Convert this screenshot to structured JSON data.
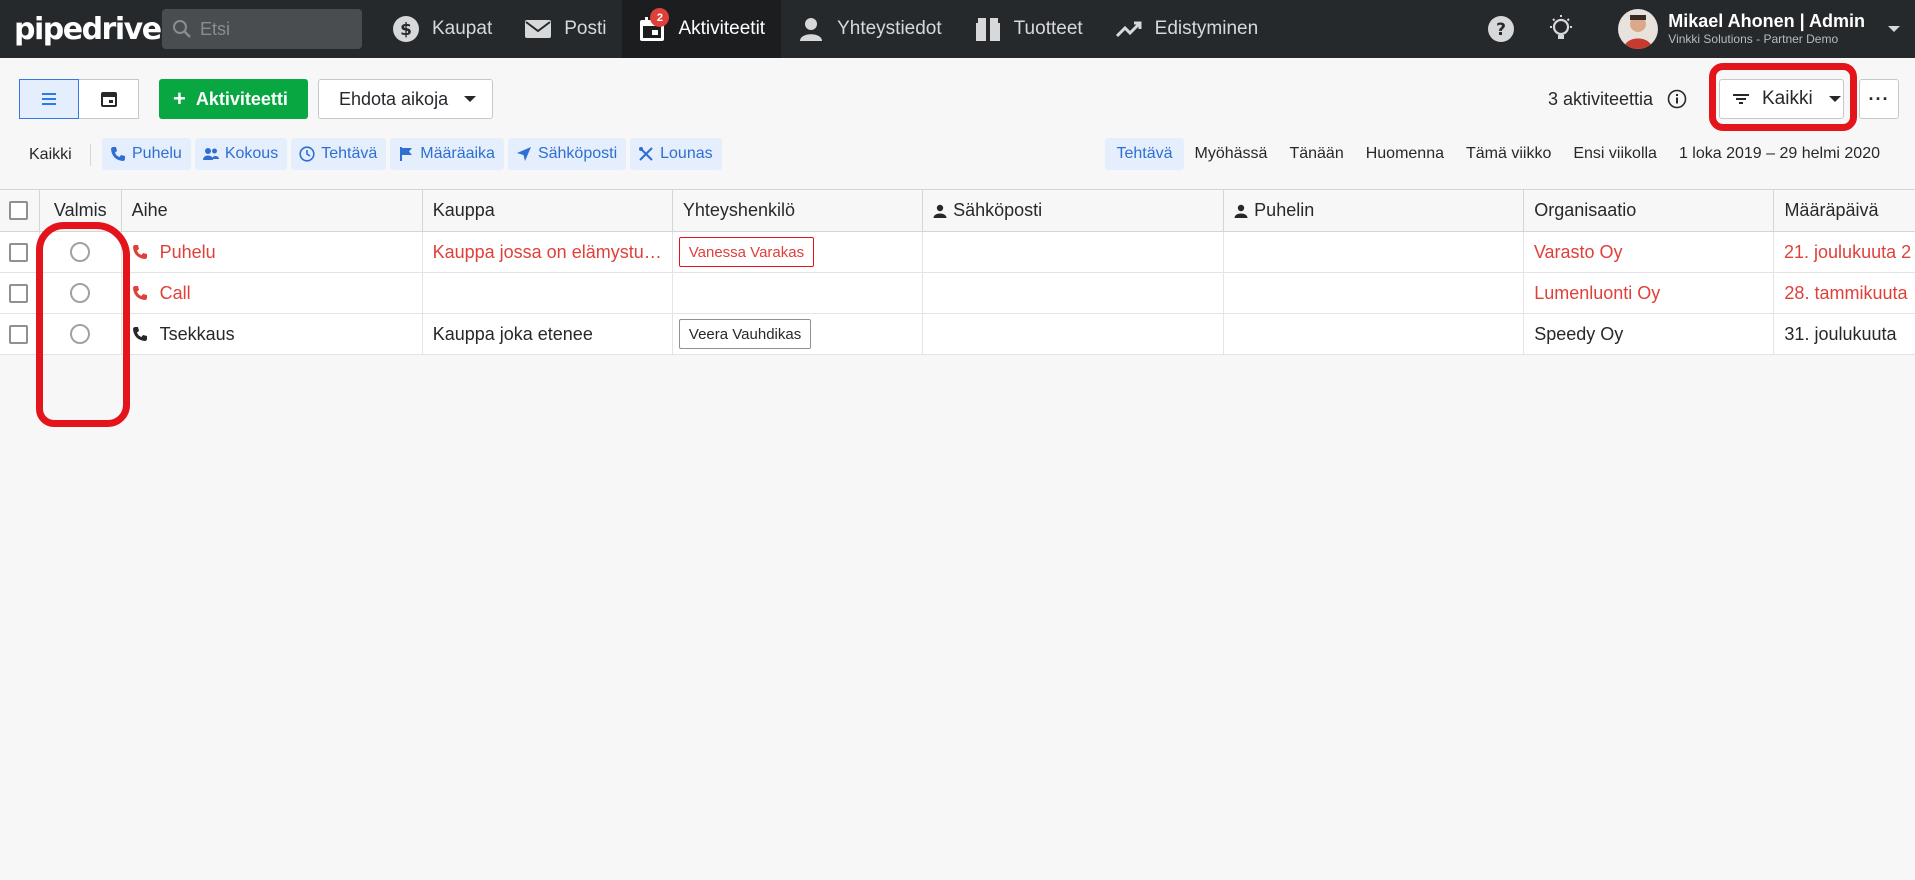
{
  "nav": {
    "logo": "pipedrive",
    "search_placeholder": "Etsi",
    "items": [
      {
        "label": "Kaupat",
        "icon": "dollar-icon"
      },
      {
        "label": "Posti",
        "icon": "mail-icon"
      },
      {
        "label": "Aktiviteetit",
        "icon": "calendar-icon",
        "badge": "2",
        "active": true
      },
      {
        "label": "Yhteystiedot",
        "icon": "person-icon"
      },
      {
        "label": "Tuotteet",
        "icon": "box-icon"
      },
      {
        "label": "Edistyminen",
        "icon": "trend-icon"
      }
    ],
    "user_name": "Mikael Ahonen | Admin",
    "user_company": "Vinkki Solutions - Partner Demo"
  },
  "toolbar": {
    "add_label": "Aktiviteetti",
    "suggest_label": "Ehdota aikoja",
    "count_label": "3 aktiviteettia",
    "filter_label": "Kaikki",
    "more_label": "···"
  },
  "types": {
    "all_label": "Kaikki",
    "chips": [
      "Puhelu",
      "Kokous",
      "Tehtävä",
      "Määräaika",
      "Sähköposti",
      "Lounas"
    ]
  },
  "periods": [
    "Tehtävä",
    "Myöhässä",
    "Tänään",
    "Huomenna",
    "Tämä viikko",
    "Ensi viikolla",
    "1 loka 2019 – 29 helmi 2020"
  ],
  "table": {
    "headers": {
      "done": "Valmis",
      "subject": "Aihe",
      "deal": "Kauppa",
      "person": "Yhteyshenkilö",
      "email": "Sähköposti",
      "phone": "Puhelin",
      "org": "Organisaatio",
      "due": "Määräpäivä"
    },
    "rows": [
      {
        "subject": "Puhelu",
        "deal": "Kauppa jossa on elämystu…",
        "person": "Vanessa Varakas",
        "org": "Varasto Oy",
        "due": "21. joulukuuta 2",
        "overdue": true
      },
      {
        "subject": "Call",
        "deal": "",
        "person": "",
        "org": "Lumenluonti Oy",
        "due": "28. tammikuuta",
        "overdue": true
      },
      {
        "subject": "Tsekkaus",
        "deal": "Kauppa joka etenee",
        "person": "Veera Vauhdikas",
        "org": "Speedy Oy",
        "due": "31. joulukuuta",
        "overdue": false
      }
    ]
  },
  "colors": {
    "nav_bg": "#26292c",
    "accent_green": "#08a742",
    "chip_blue": "#2f6fd3",
    "overdue_red": "#e0403a",
    "annotation_red": "#e3141b"
  }
}
